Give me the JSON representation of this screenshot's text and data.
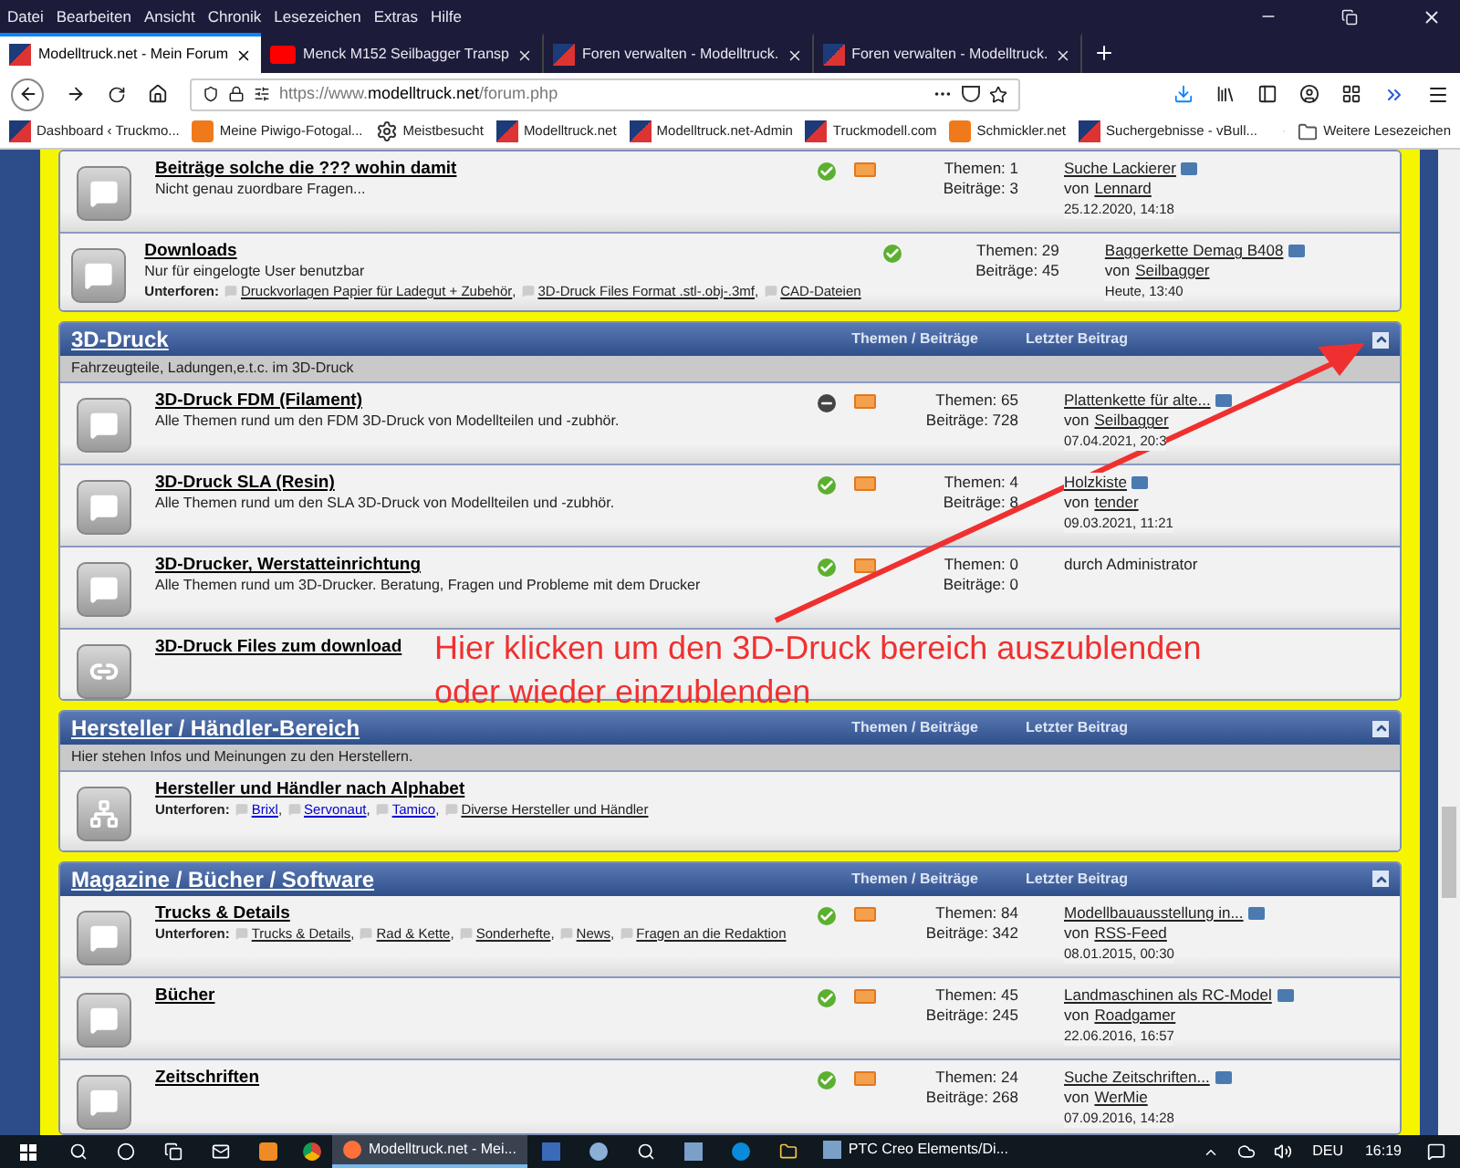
{
  "menu": [
    "Datei",
    "Bearbeiten",
    "Ansicht",
    "Chronik",
    "Lesezeichen",
    "Extras",
    "Hilfe"
  ],
  "tabs": [
    {
      "title": "Modelltruck.net - Mein Forum",
      "kind": "site",
      "selected": true
    },
    {
      "title": "Menck M152 Seilbagger Transp",
      "kind": "video",
      "selected": false
    },
    {
      "title": "Foren verwalten - Modelltruck.",
      "kind": "site",
      "selected": false
    },
    {
      "title": "Foren verwalten - Modelltruck.",
      "kind": "site",
      "selected": false
    }
  ],
  "url": {
    "prefix": "https://www.",
    "domain": "modelltruck.net",
    "path": "/forum.php"
  },
  "bookmarks": [
    {
      "label": "Dashboard ‹ Truckmo...",
      "kind": "site"
    },
    {
      "label": "Meine Piwigo-Fotogal...",
      "kind": "photo"
    },
    {
      "label": "Meistbesucht",
      "kind": "gear"
    },
    {
      "label": "Modelltruck.net",
      "kind": "site"
    },
    {
      "label": "Modelltruck.net-Admin",
      "kind": "site"
    },
    {
      "label": "Truckmodell.com",
      "kind": "site"
    },
    {
      "label": "Schmickler.net",
      "kind": "photo"
    },
    {
      "label": "Suchergebnisse - vBull...",
      "kind": "site"
    }
  ],
  "other_bookmarks": "Weitere Lesezeichen",
  "categories": [
    {
      "forums": [
        {
          "title": "Beiträge solche die ??? wohin damit",
          "description": "Nicht genau zuordbare Fragen...",
          "kind": "bubble",
          "new_posts": true,
          "rss": true,
          "stats": [
            "Themen: 1",
            "Beiträge: 3"
          ],
          "last": {
            "title": "Suche Lackierer",
            "by": "von",
            "author": "Lennard",
            "date": "25.12.2020, 14:18"
          }
        },
        {
          "title": "Downloads",
          "description": "Nur für eingelogte User benutzbar",
          "kind": "bubble",
          "new_posts": true,
          "rss": false,
          "subforums_label": "Unterforen:",
          "subforums": [
            {
              "label": "Druckvorlagen Papier für Ladegut + Zubehör",
              "suffix": ",",
              "visited": true
            },
            {
              "label": "3D-Druck Files Format .stl-.obj-.3mf",
              "suffix": ",",
              "visited": true
            },
            {
              "label": "CAD-Dateien",
              "visited": true
            }
          ],
          "stats": [
            "Themen: 29",
            "Beiträge: 45"
          ],
          "last": {
            "title": "Baggerkette Demag B408",
            "by": "von",
            "author": "Seilbagger",
            "date": "Heute, 13:40"
          }
        }
      ]
    },
    {
      "title": "3D-Druck",
      "columns": [
        "Themen / Beiträge",
        "Letzter Beitrag"
      ],
      "description": "Fahrzeugteile, Ladungen,e.t.c. im 3D-Druck",
      "forums": [
        {
          "title": "3D-Druck FDM (Filament)",
          "description": "Alle Themen rund um den FDM 3D-Druck von Modellteilen und -zubhör.",
          "kind": "bubble",
          "new_posts": false,
          "rss": true,
          "stats": [
            "Themen: 65",
            "Beiträge: 728"
          ],
          "last": {
            "title": "Plattenkette für alte...",
            "by": "von",
            "author": "Seilbagger",
            "date": "07.04.2021, 20:3"
          }
        },
        {
          "title": "3D-Druck SLA (Resin)",
          "description": "Alle Themen rund um den SLA 3D-Druck von Modellteilen und -zubhör.",
          "kind": "bubble",
          "new_posts": true,
          "rss": true,
          "stats": [
            "Themen: 4",
            "Beiträge: 8"
          ],
          "last": {
            "title": "Holzkiste",
            "by": "von",
            "author": "tender",
            "date": "09.03.2021, 11:21"
          }
        },
        {
          "title": "3D-Drucker, Werstatteinrichtung",
          "description": "Alle Themen rund um 3D-Drucker. Beratung, Fragen und Probleme mit dem Drucker",
          "kind": "bubble",
          "new_posts": true,
          "rss": true,
          "stats": [
            "Themen: 0",
            "Beiträge: 0"
          ],
          "last": {
            "text": "durch Administrator"
          }
        },
        {
          "title": "3D-Druck Files zum download",
          "kind": "link"
        }
      ]
    },
    {
      "title": "Hersteller / Händler-Bereich",
      "columns": [
        "Themen / Beiträge",
        "Letzter Beitrag"
      ],
      "description": "Hier stehen Infos und Meinungen zu den Herstellern.",
      "forums": [
        {
          "title": "Hersteller und Händler nach Alphabet",
          "kind": "sitemap",
          "subforums_label": "Unterforen:",
          "subforums": [
            {
              "label": "Brixl",
              "suffix": ",",
              "visited": false
            },
            {
              "label": "Servonaut",
              "suffix": ",",
              "visited": false
            },
            {
              "label": "Tamico",
              "suffix": ",",
              "visited": false
            },
            {
              "label": "Diverse Hersteller und Händler",
              "visited": true
            }
          ]
        }
      ]
    },
    {
      "title": "Magazine / Bücher / Software",
      "columns": [
        "Themen / Beiträge",
        "Letzter Beitrag"
      ],
      "forums": [
        {
          "title": "Trucks & Details",
          "kind": "bubble",
          "new_posts": true,
          "rss": true,
          "subforums_label": "Unterforen:",
          "subforums": [
            {
              "label": "Trucks & Details",
              "suffix": ",",
              "visited": true
            },
            {
              "label": "Rad & Kette",
              "suffix": ",",
              "visited": true
            },
            {
              "label": "Sonderhefte",
              "suffix": ",",
              "visited": true
            },
            {
              "label": "News",
              "suffix": ",",
              "visited": true
            },
            {
              "label": "Fragen an die Redaktion",
              "visited": true
            }
          ],
          "stats": [
            "Themen: 84",
            "Beiträge: 342"
          ],
          "last": {
            "title": "Modellbauausstellung in...",
            "by": "von",
            "author": "RSS-Feed",
            "date": "08.01.2015, 00:30"
          }
        },
        {
          "title": "Bücher",
          "kind": "bubble",
          "new_posts": true,
          "rss": true,
          "stats": [
            "Themen: 45",
            "Beiträge: 245"
          ],
          "last": {
            "title": "Landmaschinen als RC-Model",
            "by": "von",
            "author": "Roadgamer",
            "date": "22.06.2016, 16:57"
          }
        },
        {
          "title": "Zeitschriften",
          "kind": "bubble",
          "new_posts": true,
          "rss": true,
          "stats": [
            "Themen: 24",
            "Beiträge: 268"
          ],
          "last": {
            "title": "Suche Zeitschriften...",
            "by": "von",
            "author": "WerMie",
            "date": "07.09.2016, 14:28"
          }
        }
      ]
    }
  ],
  "annotation": "Hier klicken um den 3D-Druck bereich auszublenden oder wieder einzublenden",
  "taskbar": {
    "apps": [
      {
        "label": "Modelltruck.net - Mei...",
        "selected": true
      },
      {
        "label": "PTC Creo Elements/Di...",
        "selected": false
      }
    ],
    "language": "DEU",
    "time": "16:19"
  }
}
